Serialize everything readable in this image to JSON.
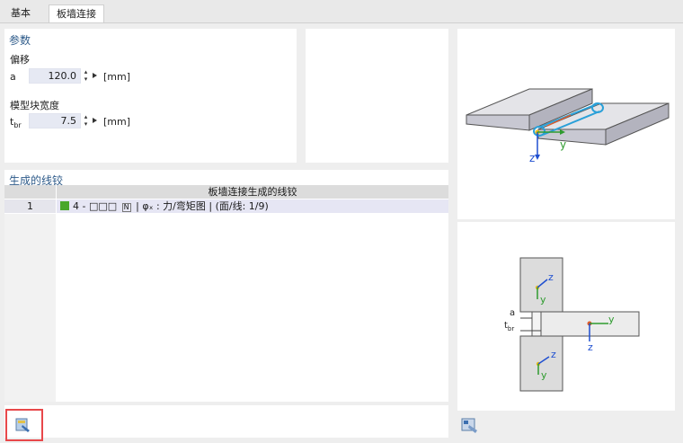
{
  "tabs": [
    {
      "label": "基本",
      "active": false
    },
    {
      "label": "板墙连接",
      "active": true
    }
  ],
  "params": {
    "title": "参数",
    "offset": {
      "label": "偏移",
      "symbol": "a",
      "value": "120.0",
      "unit": "[mm]"
    },
    "block_width": {
      "label": "模型块宽度",
      "symbol_main": "t",
      "symbol_sub": "br",
      "value": "7.5",
      "unit": "[mm]"
    }
  },
  "hinges": {
    "title": "生成的线铰",
    "column_header": "板墙连接生成的线铰",
    "rows": [
      {
        "num": "1",
        "prefix": "4 - □□□",
        "badge": "N",
        "text": " | φₓ : 力/弯矩图 | (面/线: 1/9)",
        "color": "#4aa72b"
      }
    ]
  },
  "diagram3d": {
    "axis_z": "z",
    "axis_y": "y"
  },
  "section": {
    "axis_z": "z",
    "axis_y": "y",
    "dim_a": "a",
    "dim_t": "t",
    "dim_t_sub": "br"
  },
  "colors": {
    "accent": "#2e5b8a",
    "highlight": "#e8484a",
    "hinge": "#4aa72b",
    "axis_z": "#1f4fd0",
    "axis_y": "#2e9b2e",
    "origin": "#e8bc1a"
  }
}
